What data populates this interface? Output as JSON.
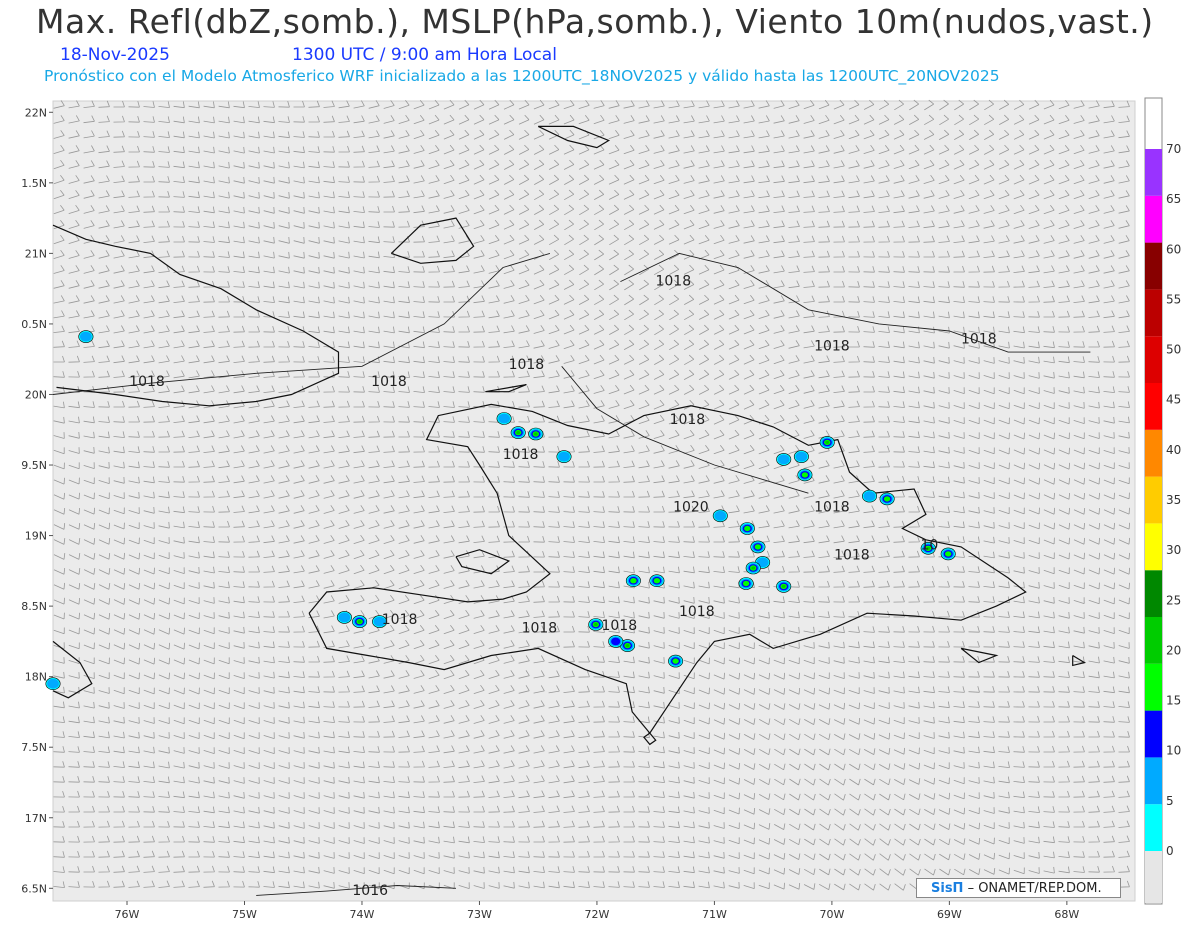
{
  "header": {
    "title": "Max. Refl(dbZ,somb.), MSLP(hPa,somb.), Viento 10m(nudos,vast.)",
    "date": "18-Nov-2025",
    "time": "1300 UTC / 9:00 am Hora Local",
    "subtitle": "Pronóstico con el Modelo Atmosferico WRF inicializado a las 1200UTC_18NOV2025 y válido hasta las  1200UTC_20NOV2025"
  },
  "axes": {
    "lat_labels": [
      "22N",
      "1.5N",
      "21N",
      "0.5N",
      "20N",
      "9.5N",
      "19N",
      "8.5N",
      "18N",
      "7.5N",
      "17N",
      "6.5N"
    ],
    "lon_labels": [
      "76W",
      "75W",
      "74W",
      "73W",
      "72W",
      "71W",
      "70W",
      "69W",
      "68W"
    ]
  },
  "isobars": {
    "labels": [
      {
        "text": "1018",
        "lon": -72.6,
        "lat": 20.21
      },
      {
        "text": "1018",
        "lon": -75.83,
        "lat": 20.09
      },
      {
        "text": "1018",
        "lon": -73.77,
        "lat": 20.09
      },
      {
        "text": "1018",
        "lon": -71.35,
        "lat": 20.8
      },
      {
        "text": "1018",
        "lon": -70.0,
        "lat": 20.34
      },
      {
        "text": "1018",
        "lon": -68.75,
        "lat": 20.39
      },
      {
        "text": "1018",
        "lon": -72.65,
        "lat": 19.57
      },
      {
        "text": "1018",
        "lon": -71.23,
        "lat": 19.82
      },
      {
        "text": "1020",
        "lon": -71.2,
        "lat": 19.2
      },
      {
        "text": "1018",
        "lon": -70.0,
        "lat": 19.2
      },
      {
        "text": "1018",
        "lon": -69.83,
        "lat": 18.86
      },
      {
        "text": "10",
        "lon": -69.17,
        "lat": 18.93
      },
      {
        "text": "1018",
        "lon": -73.68,
        "lat": 18.4
      },
      {
        "text": "1018",
        "lon": -72.49,
        "lat": 18.34
      },
      {
        "text": "1018",
        "lon": -71.81,
        "lat": 18.36
      },
      {
        "text": "1018",
        "lon": -71.15,
        "lat": 18.46
      },
      {
        "text": "1016",
        "lon": -73.93,
        "lat": 16.48
      }
    ]
  },
  "colorbar": {
    "labels": [
      "0",
      "5",
      "10",
      "15",
      "20",
      "25",
      "30",
      "35",
      "40",
      "45",
      "50",
      "55",
      "60",
      "65",
      "70"
    ],
    "colors": [
      "#00ffff",
      "#00aaff",
      "#0000ff",
      "#00ff00",
      "#00cc00",
      "#008800",
      "#ffff00",
      "#ffcc00",
      "#ff8800",
      "#ff0000",
      "#dd0000",
      "#bb0000",
      "#880000",
      "#ff00ff",
      "#9933ff"
    ],
    "colors_note_order": "bottom-to-top"
  },
  "reflectivity_cells": [
    {
      "lon": -72.67,
      "lat": 19.73,
      "dbz": 25
    },
    {
      "lon": -72.52,
      "lat": 19.72,
      "dbz": 25
    },
    {
      "lon": -72.79,
      "lat": 19.83,
      "dbz": 5
    },
    {
      "lon": -72.28,
      "lat": 19.56,
      "dbz": 5
    },
    {
      "lon": -76.35,
      "lat": 20.41,
      "dbz": 5
    },
    {
      "lon": -70.04,
      "lat": 19.66,
      "dbz": 20
    },
    {
      "lon": -70.41,
      "lat": 19.54,
      "dbz": 5
    },
    {
      "lon": -70.23,
      "lat": 19.43,
      "dbz": 15
    },
    {
      "lon": -70.26,
      "lat": 19.56,
      "dbz": 5
    },
    {
      "lon": -70.95,
      "lat": 19.14,
      "dbz": 5
    },
    {
      "lon": -70.72,
      "lat": 19.05,
      "dbz": 15
    },
    {
      "lon": -70.63,
      "lat": 18.92,
      "dbz": 15
    },
    {
      "lon": -70.59,
      "lat": 18.81,
      "dbz": 5
    },
    {
      "lon": -70.67,
      "lat": 18.77,
      "dbz": 40
    },
    {
      "lon": -70.41,
      "lat": 18.64,
      "dbz": 30
    },
    {
      "lon": -70.73,
      "lat": 18.66,
      "dbz": 15
    },
    {
      "lon": -69.53,
      "lat": 19.26,
      "dbz": 15
    },
    {
      "lon": -69.68,
      "lat": 19.28,
      "dbz": 5
    },
    {
      "lon": -69.18,
      "lat": 18.91,
      "dbz": 20
    },
    {
      "lon": -69.01,
      "lat": 18.87,
      "dbz": 15
    },
    {
      "lon": -71.74,
      "lat": 18.22,
      "dbz": 30
    },
    {
      "lon": -71.84,
      "lat": 18.25,
      "dbz": 10
    },
    {
      "lon": -72.01,
      "lat": 18.37,
      "dbz": 20
    },
    {
      "lon": -71.69,
      "lat": 18.68,
      "dbz": 15
    },
    {
      "lon": -71.49,
      "lat": 18.68,
      "dbz": 15
    },
    {
      "lon": -71.33,
      "lat": 18.11,
      "dbz": 15
    },
    {
      "lon": -74.02,
      "lat": 18.39,
      "dbz": 25
    },
    {
      "lon": -74.15,
      "lat": 18.42,
      "dbz": 5
    },
    {
      "lon": -73.85,
      "lat": 18.39,
      "dbz": 5
    },
    {
      "lon": -76.63,
      "lat": 17.95,
      "dbz": 5
    }
  ],
  "credit": {
    "logo": "SisΠ",
    "text": " – ONAMET/REP.DOM."
  },
  "colors": {
    "plot_background": "#ebebeb",
    "barb_color": "#8a8a8a",
    "coast_color": "#111111",
    "title_color": "#333333",
    "date_color": "#1a3aff",
    "subtitle_color": "#18a8e6"
  }
}
